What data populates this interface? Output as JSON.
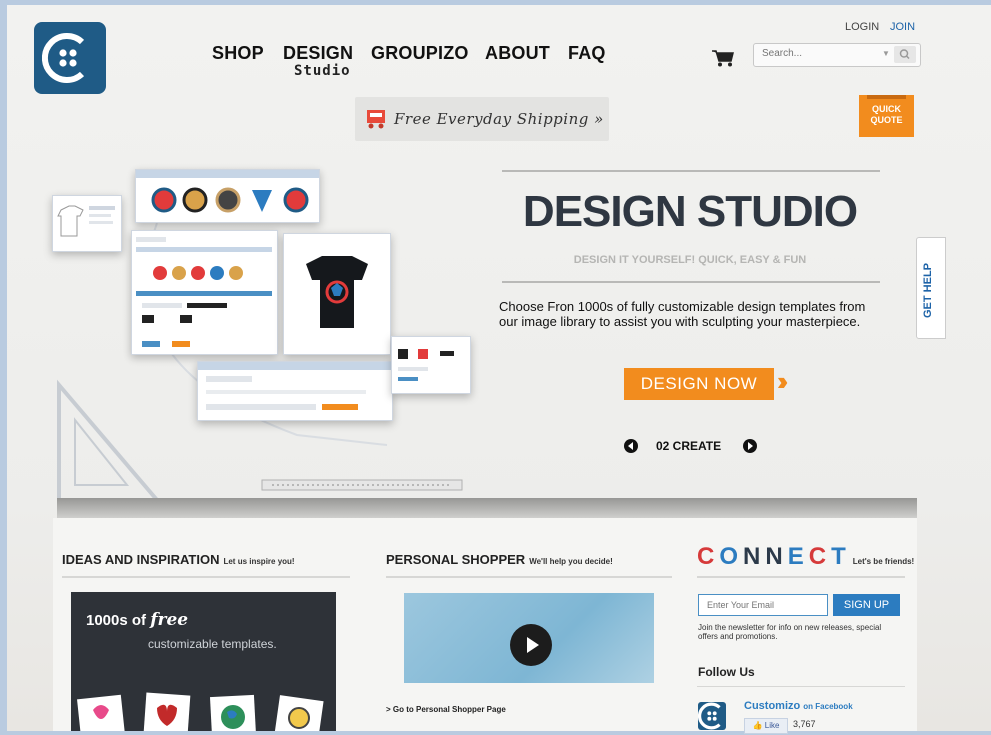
{
  "header": {
    "nav": [
      "SHOP",
      "DESIGN",
      "GROUPIZO",
      "ABOUT",
      "FAQ"
    ],
    "design_sub": "Studio",
    "login": "LOGIN",
    "join": "JOIN",
    "search_placeholder": "Search..."
  },
  "banner": {
    "shipping": "Free Everyday Shipping »",
    "quick_quote_line1": "QUICK",
    "quick_quote_line2": "QUOTE"
  },
  "hero": {
    "title": "DESIGN STUDIO",
    "subtitle": "DESIGN IT YOURSELF! QUICK, EASY & FUN",
    "description": "Choose Fron 1000s of fully customizable design templates from our image library to assist you with sculpting your masterpiece.",
    "cta": "DESIGN NOW",
    "slide_label": "02 CREATE",
    "get_help": "GET HELP"
  },
  "ideas": {
    "title": "IDEAS AND INSPIRATION",
    "subtitle": "Let us inspire you!",
    "promo_prefix": "1000s of",
    "promo_free": "free",
    "promo_line2": "customizable templates."
  },
  "shopper": {
    "title": "PERSONAL SHOPPER",
    "subtitle": "We'll help you decide!",
    "link": "> Go to Personal Shopper Page"
  },
  "connect": {
    "title_letters": [
      "C",
      "O",
      "N",
      "N",
      "E",
      "C",
      "T"
    ],
    "title_colors": [
      "#d63a3a",
      "#2c7cc0",
      "#2c3a4a",
      "#2c3a4a",
      "#2c7cc0",
      "#d63a3a",
      "#2c7cc0"
    ],
    "subtitle": "Let's be friends!",
    "email_placeholder": "Enter Your Email",
    "signup": "SIGN UP",
    "note": "Join the newsletter for info on new releases, special offers and promotions.",
    "follow_title": "Follow Us",
    "fb_name": "Customizo",
    "fb_on": "on Facebook",
    "like": "Like",
    "like_count": "3,767"
  },
  "colors": {
    "brand_blue": "#1f5b86",
    "accent_orange": "#f28c1e",
    "link_blue": "#2c7cc0"
  }
}
